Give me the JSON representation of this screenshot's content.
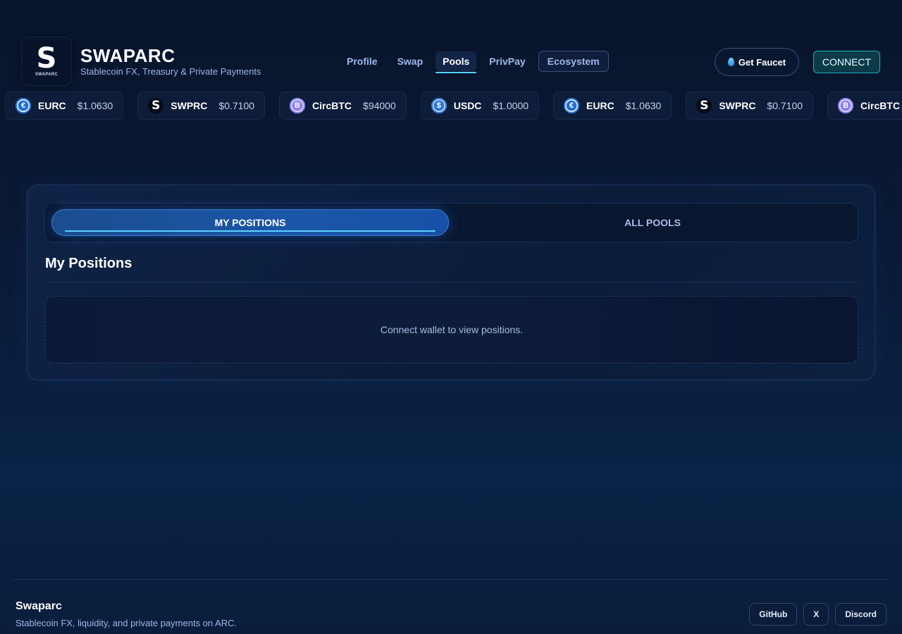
{
  "brand": {
    "logo_letter": "S",
    "logo_sub": "SWAPARC",
    "title": "SWAPARC",
    "tagline": "Stablecoin FX, Treasury & Private Payments"
  },
  "nav": {
    "items": [
      {
        "label": "Profile",
        "active": false
      },
      {
        "label": "Swap",
        "active": false
      },
      {
        "label": "Pools",
        "active": true
      },
      {
        "label": "PrivPay",
        "active": false
      },
      {
        "label": "Ecosystem",
        "active": false
      }
    ]
  },
  "header_actions": {
    "faucet_label": "Get Faucet",
    "faucet_icon": "droplet-icon",
    "connect_label": "CONNECT"
  },
  "ticker": [
    {
      "symbol": "EURC",
      "price": "$1.0630",
      "icon": "eurc-coin-icon",
      "glyph": "€"
    },
    {
      "symbol": "SWPRC",
      "price": "$0.7100",
      "icon": "swprc-coin-icon",
      "glyph": "S"
    },
    {
      "symbol": "CircBTC",
      "price": "$94000",
      "icon": "circbtc-coin-icon",
      "glyph": "B"
    },
    {
      "symbol": "USDC",
      "price": "$1.0000",
      "icon": "usdc-coin-icon",
      "glyph": "$"
    },
    {
      "symbol": "EURC",
      "price": "$1.0630",
      "icon": "eurc-coin-icon",
      "glyph": "€"
    },
    {
      "symbol": "SWPRC",
      "price": "$0.7100",
      "icon": "swprc-coin-icon",
      "glyph": "S"
    },
    {
      "symbol": "CircBTC",
      "price": "",
      "icon": "circbtc-coin-icon",
      "glyph": "B"
    }
  ],
  "pools": {
    "tabs": [
      {
        "label": "MY POSITIONS",
        "active": true
      },
      {
        "label": "ALL POOLS",
        "active": false
      }
    ],
    "section_title": "My Positions",
    "empty_message": "Connect wallet to view positions."
  },
  "footer": {
    "title": "Swaparc",
    "tagline": "Stablecoin FX, liquidity, and private payments on ARC.",
    "links": [
      "GitHub",
      "X",
      "Discord"
    ]
  },
  "colors": {
    "accent": "#4fd2ff",
    "connect_border": "#1fb3b3",
    "tab_active": "#1a56a8",
    "background": "#0a1a36"
  }
}
